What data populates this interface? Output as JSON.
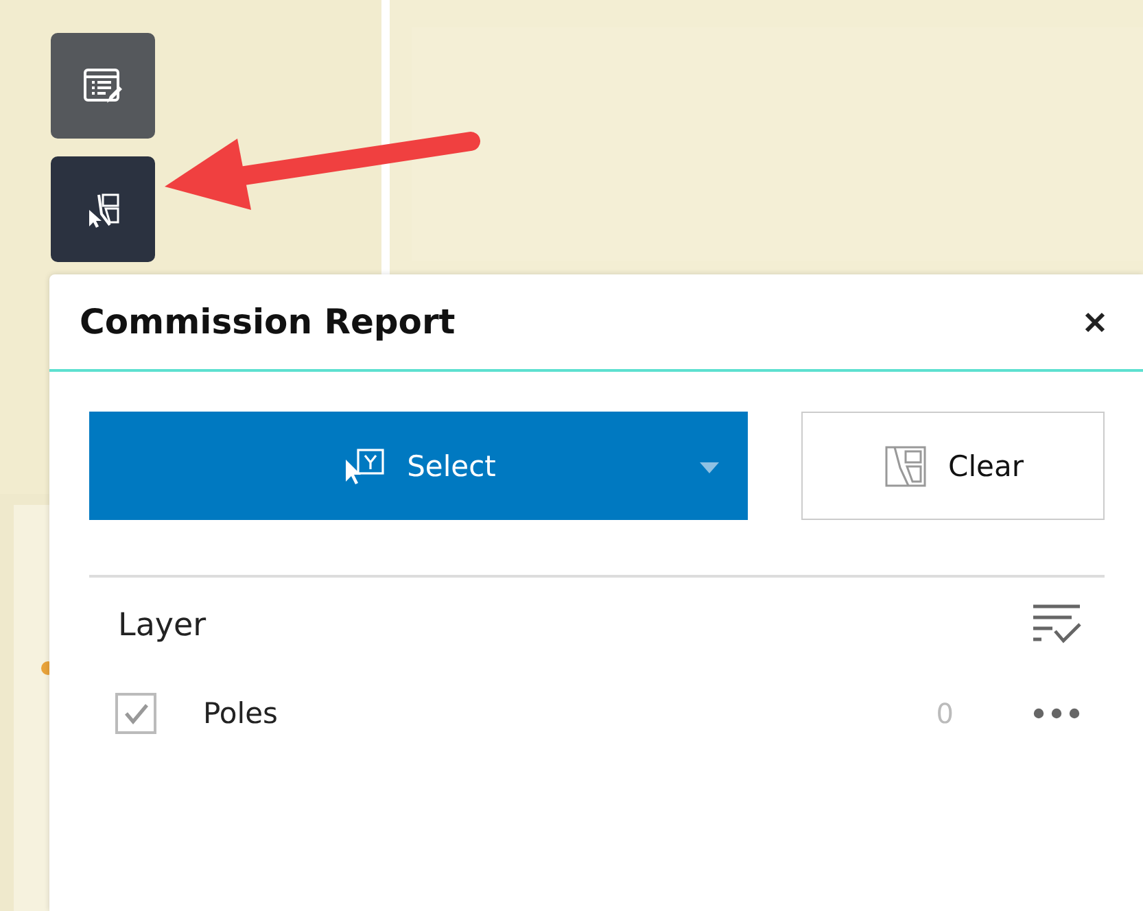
{
  "toolbar": [
    {
      "kind": "report",
      "selected": false
    },
    {
      "kind": "select",
      "selected": true
    }
  ],
  "panel": {
    "title": "Commission Report",
    "select_button": {
      "label": "Select"
    },
    "clear_button": {
      "label": "Clear"
    },
    "layer_header": "Layer",
    "layers": [
      {
        "name": "Poles",
        "checked": true,
        "count": "0"
      }
    ]
  }
}
